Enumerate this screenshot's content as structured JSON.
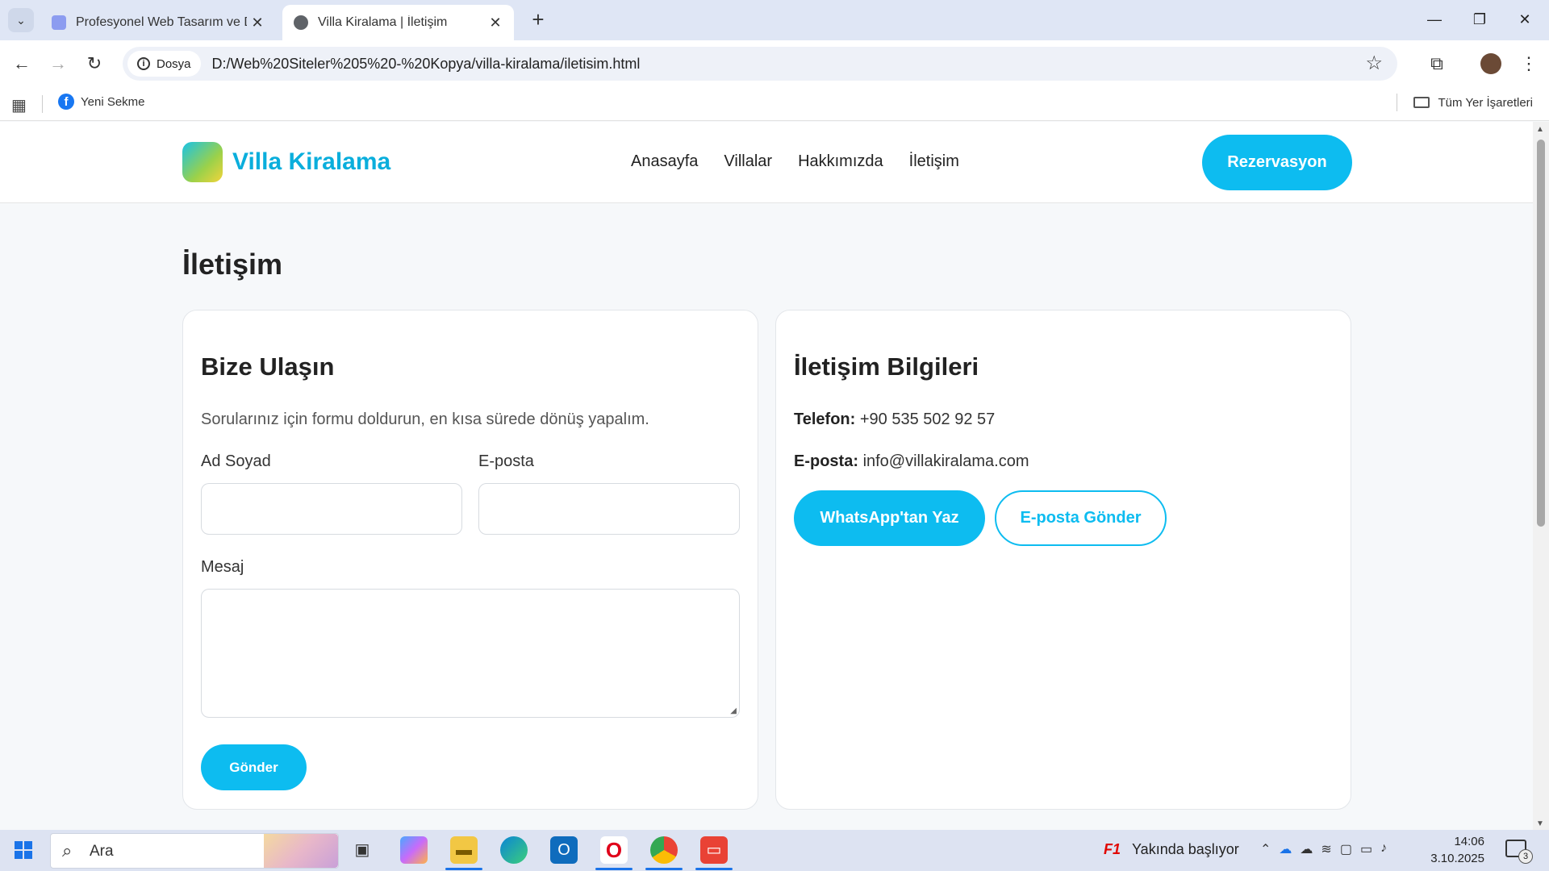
{
  "browser": {
    "tabs": [
      {
        "title": "Profesyonel Web Tasarım ve Dij",
        "active": false
      },
      {
        "title": "Villa Kiralama | İletişim",
        "active": true
      }
    ],
    "new_tab": "+",
    "site_info_label": "Dosya",
    "url": "D:/Web%20Siteler%205%20-%20Kopya/villa-kiralama/iletisim.html",
    "bookmarks": [
      {
        "label": "Yeni Sekme"
      }
    ],
    "all_bookmarks_label": "Tüm Yer İşaretleri"
  },
  "site": {
    "brand": "Villa Kiralama",
    "nav": [
      "Anasayfa",
      "Villalar",
      "Hakkımızda",
      "İletişim"
    ],
    "cta": "Rezervasyon"
  },
  "page": {
    "title": "İletişim",
    "form_card": {
      "heading": "Bize Ulaşın",
      "intro": "Sorularınız için formu doldurun, en kısa sürede dönüş yapalım.",
      "name_label": "Ad Soyad",
      "name_value": "",
      "email_label": "E-posta",
      "email_value": "",
      "message_label": "Mesaj",
      "message_value": "",
      "submit": "Gönder"
    },
    "info_card": {
      "heading": "İletişim Bilgileri",
      "phone_label": "Telefon:",
      "phone_value": "+90 535 502 92 57",
      "email_label": "E-posta:",
      "email_value": "info@villakiralama.com",
      "whatsapp_button": "WhatsApp'tan Yaz",
      "email_button": "E-posta Gönder"
    }
  },
  "colors": {
    "accent": "#0dbcf0",
    "brand_text": "#0aaedc"
  },
  "taskbar": {
    "search_placeholder": "Ara",
    "weather_text": "Yakında başlıyor",
    "weather_badge": "F1",
    "time": "14:06",
    "date": "3.10.2025",
    "notification_count": "3"
  }
}
